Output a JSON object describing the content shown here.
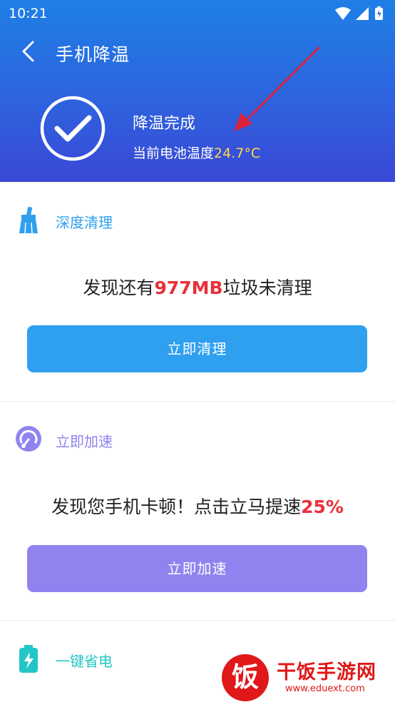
{
  "status_bar": {
    "time": "10:21"
  },
  "header": {
    "title": "手机降温",
    "status_title": "降温完成",
    "temp_label": "当前电池温度",
    "temp_value": "24.7°C"
  },
  "sections": [
    {
      "title": "深度清理",
      "icon": "broom-icon",
      "accent": "#2f9ff0",
      "msg_prefix": "发现还有",
      "msg_highlight": "977MB",
      "msg_suffix": "垃圾未清理",
      "button_label": "立即清理"
    },
    {
      "title": "立即加速",
      "icon": "speedometer-icon",
      "accent": "#8f84ef",
      "msg_prefix": "发现您手机卡顿！点击立马提速",
      "msg_highlight": "25%",
      "msg_suffix": "",
      "button_label": "立即加速"
    },
    {
      "title": "一键省电",
      "icon": "battery-icon",
      "accent": "#23c6c6"
    }
  ],
  "watermark": {
    "name": "干饭手游网",
    "url": "www.eduext.com"
  },
  "colors": {
    "header_top": "#1e7fe6",
    "header_bottom": "#3a48d6",
    "highlight": "#e8303a",
    "temp_value": "#ffd84a"
  }
}
